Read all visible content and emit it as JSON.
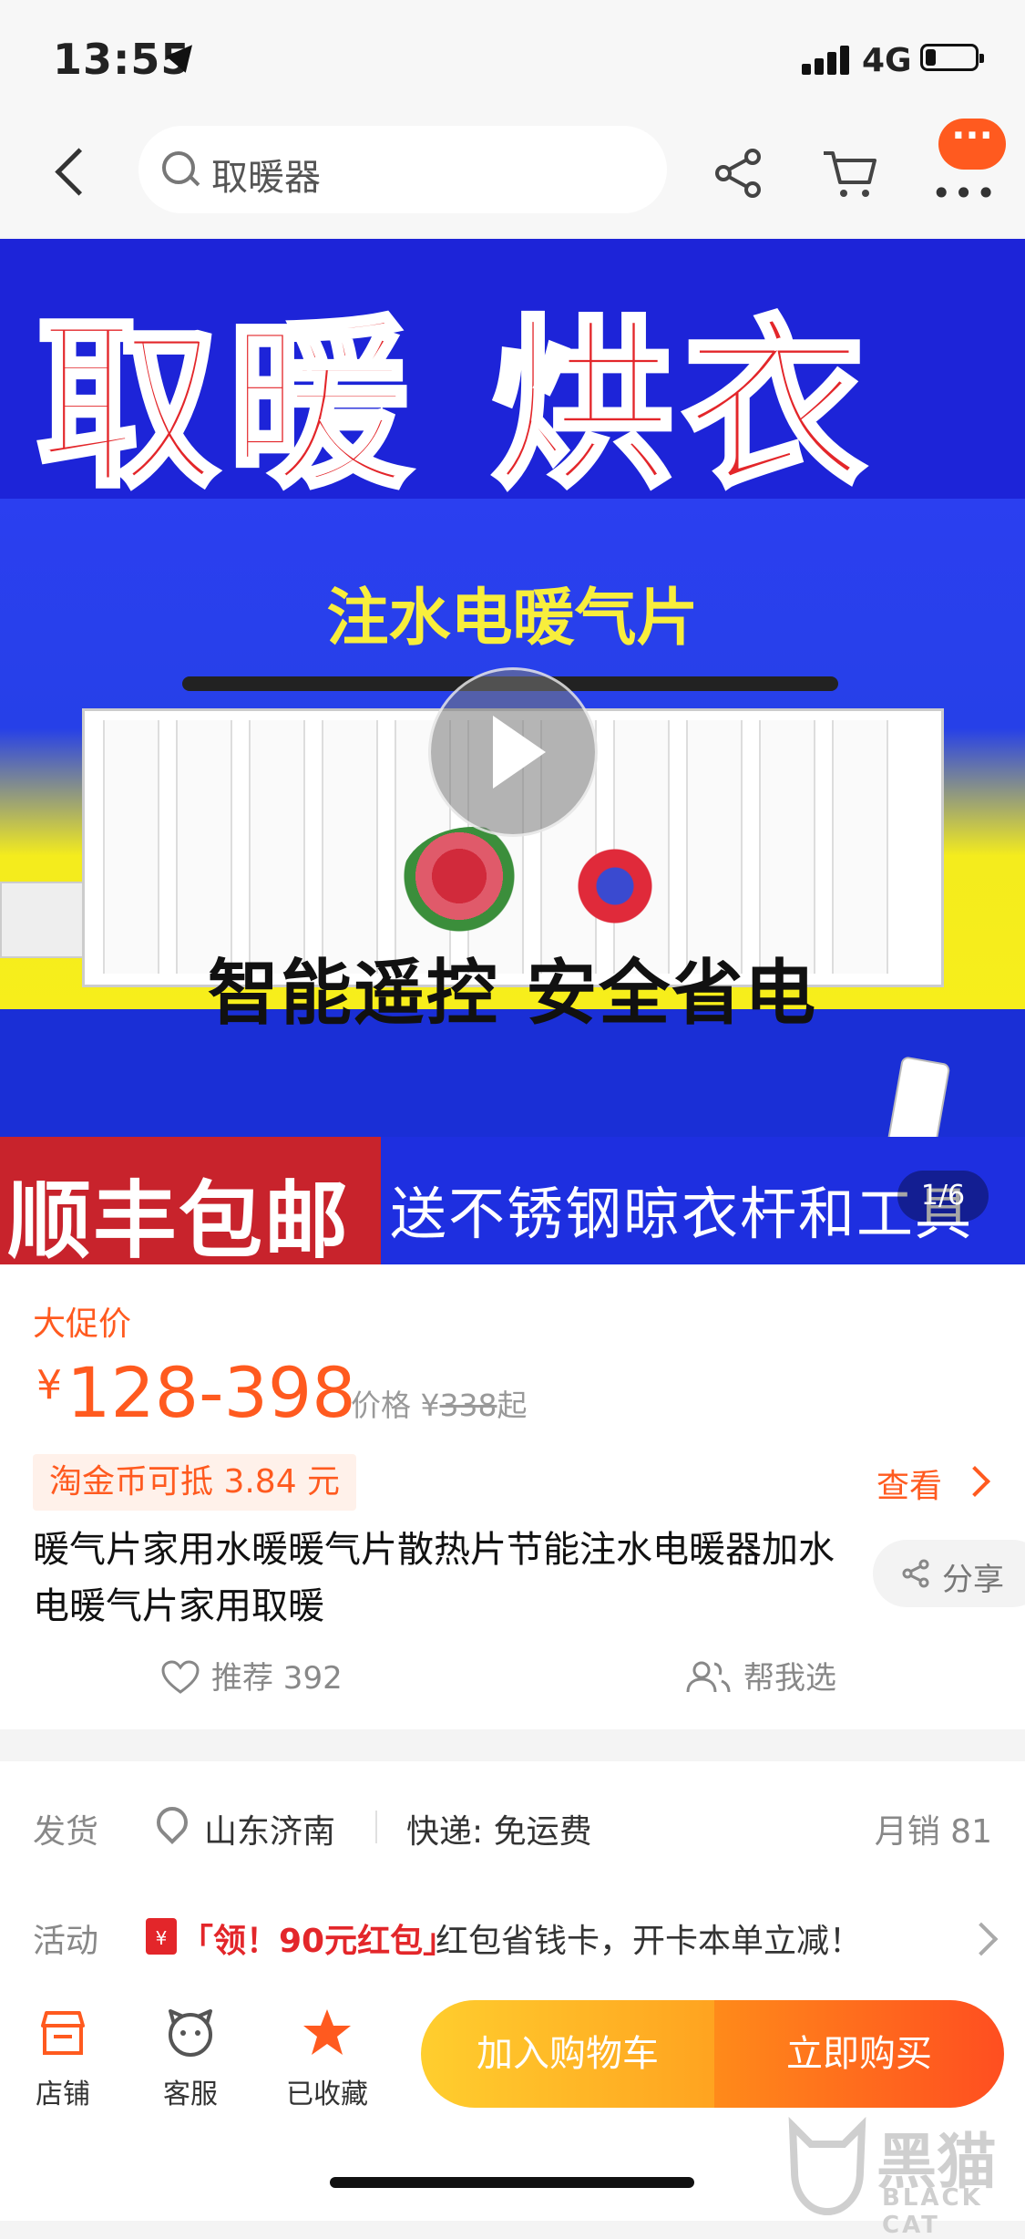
{
  "status_bar": {
    "time": "13:55",
    "network": "4G"
  },
  "nav": {
    "search_query": "取暖器",
    "more_bubble": "···"
  },
  "banner": {
    "headline": "取暖 烘衣",
    "subtitle": "注水电暖气片",
    "slogan": "智能遥控 安全省电",
    "shipping_badge": "顺丰包邮",
    "gift_text": "送不锈钢晾衣杆和工具",
    "pager": "1/6",
    "colors": {
      "blue": "#1d24d8",
      "red": "#e3262a",
      "yellow": "#f7ee1b"
    }
  },
  "product": {
    "promo_label": "大促价",
    "currency": "¥",
    "price_range": "128-398",
    "orig_label": "价格 ¥",
    "orig_price": "338",
    "orig_suffix": "起",
    "coin_text": "淘金币可抵 3.84 元",
    "view_label": "查看",
    "title": "暖气片家用水暖暖气片散热片节能注水电暖器加水电暖气片家用取暖",
    "share_label": "分享",
    "recommend_label": "推荐 392",
    "help_label": "帮我选"
  },
  "shipping": {
    "label": "发货",
    "location": "山东济南",
    "express": "快递: 免运费",
    "monthly_sales": "月销 81"
  },
  "activity": {
    "label": "活动",
    "tag": "「领！90元红包」",
    "text": "红包省钱卡，开卡本单立减！"
  },
  "bottom_bar": {
    "store": "店铺",
    "service": "客服",
    "favorited": "已收藏",
    "add_to_cart": "加入购物车",
    "buy_now": "立即购买"
  },
  "watermark": {
    "zh": "黑猫",
    "en": "BLACK CAT"
  },
  "theme": {
    "accent": "#ff5a1f"
  }
}
